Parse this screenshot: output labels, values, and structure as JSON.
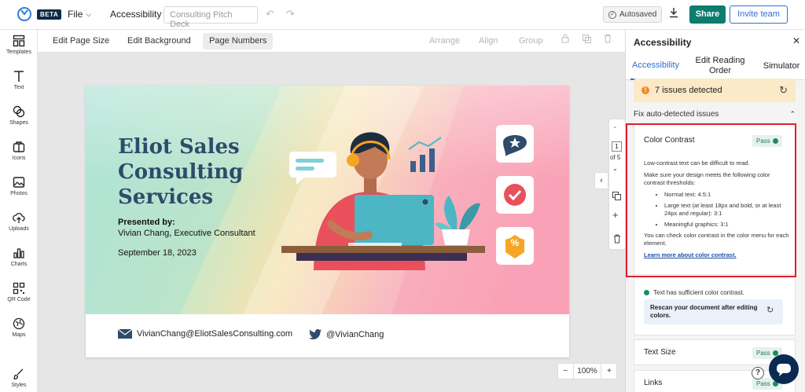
{
  "topbar": {
    "beta": "BETA",
    "file": "File",
    "title": "Accessibility",
    "doc_placeholder": "Consulting Pitch Deck",
    "autosaved": "Autosaved",
    "share": "Share",
    "invite": "Invite team"
  },
  "sidebar": {
    "items": [
      {
        "label": "Templates",
        "icon": "templates-icon"
      },
      {
        "label": "Text",
        "icon": "text-icon"
      },
      {
        "label": "Shapes",
        "icon": "shapes-icon"
      },
      {
        "label": "Icons",
        "icon": "icons-icon"
      },
      {
        "label": "Photos",
        "icon": "photos-icon"
      },
      {
        "label": "Uploads",
        "icon": "uploads-icon"
      },
      {
        "label": "Charts",
        "icon": "charts-icon"
      },
      {
        "label": "QR Code",
        "icon": "qr-code-icon"
      },
      {
        "label": "Maps",
        "icon": "maps-icon"
      },
      {
        "label": "Styles",
        "icon": "styles-icon"
      }
    ]
  },
  "toolbar": {
    "edit_page_size": "Edit Page Size",
    "edit_background": "Edit Background",
    "page_numbers": "Page Numbers",
    "arrange": "Arrange",
    "align": "Align",
    "group": "Group"
  },
  "slide": {
    "title_line1": "Eliot Sales",
    "title_line2": "Consulting",
    "title_line3": "Services",
    "presented_by": "Presented by:",
    "presenter": "Vivian Chang, Executive Consultant",
    "date": "September 18, 2023",
    "email": "VivianChang@EliotSalesConsulting.com",
    "twitter": "@VivianChang",
    "badge_percent": "%"
  },
  "pager": {
    "current": "1",
    "of": "of 5"
  },
  "zoom": {
    "minus": "−",
    "value": "100%",
    "plus": "+"
  },
  "panel": {
    "title": "Accessibility",
    "tabs": [
      "Accessibility",
      "Edit Reading Order",
      "Simulator"
    ],
    "issues": "7 issues detected",
    "fix_heading": "Fix auto-detected issues",
    "color_contrast": {
      "title": "Color Contrast",
      "badge": "Pass",
      "intro": "Low-contrast text can be difficult to read.",
      "requirement": "Make sure your design meets the following color contrast thresholds:",
      "thresholds": [
        "Normal text: 4.5:1",
        "Large text (at least 18px and bold, or at least 24px and regular): 3:1",
        "Meaningful graphics: 3:1"
      ],
      "check_text": "You can check color contrast in the color menu for each element.",
      "link": "Learn more about color contrast.",
      "status": "Text has sufficient color contrast.",
      "rescan": "Rescan your document after editing colors."
    },
    "text_size": {
      "title": "Text Size",
      "badge": "Pass"
    },
    "links": {
      "title": "Links",
      "badge": "Pass"
    }
  }
}
